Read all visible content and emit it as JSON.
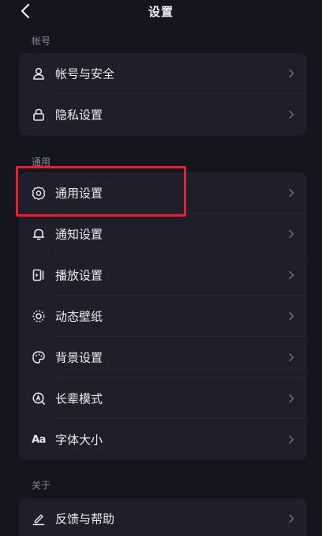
{
  "header": {
    "title": "设置"
  },
  "sections": {
    "account": {
      "label": "帐号",
      "items": [
        {
          "label": "帐号与安全",
          "icon": "user-icon"
        },
        {
          "label": "隐私设置",
          "icon": "lock-icon"
        }
      ]
    },
    "general": {
      "label": "通用",
      "items": [
        {
          "label": "通用设置",
          "icon": "gear-icon"
        },
        {
          "label": "通知设置",
          "icon": "bell-icon"
        },
        {
          "label": "播放设置",
          "icon": "play-settings-icon"
        },
        {
          "label": "动态壁纸",
          "icon": "wallpaper-icon"
        },
        {
          "label": "背景设置",
          "icon": "palette-icon"
        },
        {
          "label": "长辈模式",
          "icon": "elder-mode-icon"
        },
        {
          "label": "字体大小",
          "icon": "font-size-icon",
          "icon_text": "Aa"
        }
      ]
    },
    "about": {
      "label": "关于",
      "items": [
        {
          "label": "反馈与帮助",
          "icon": "edit-icon"
        }
      ]
    }
  },
  "colors": {
    "background": "#15151f",
    "card": "#1f1f2b",
    "highlight": "#e0232f",
    "secondary_text": "#8a8a96"
  }
}
